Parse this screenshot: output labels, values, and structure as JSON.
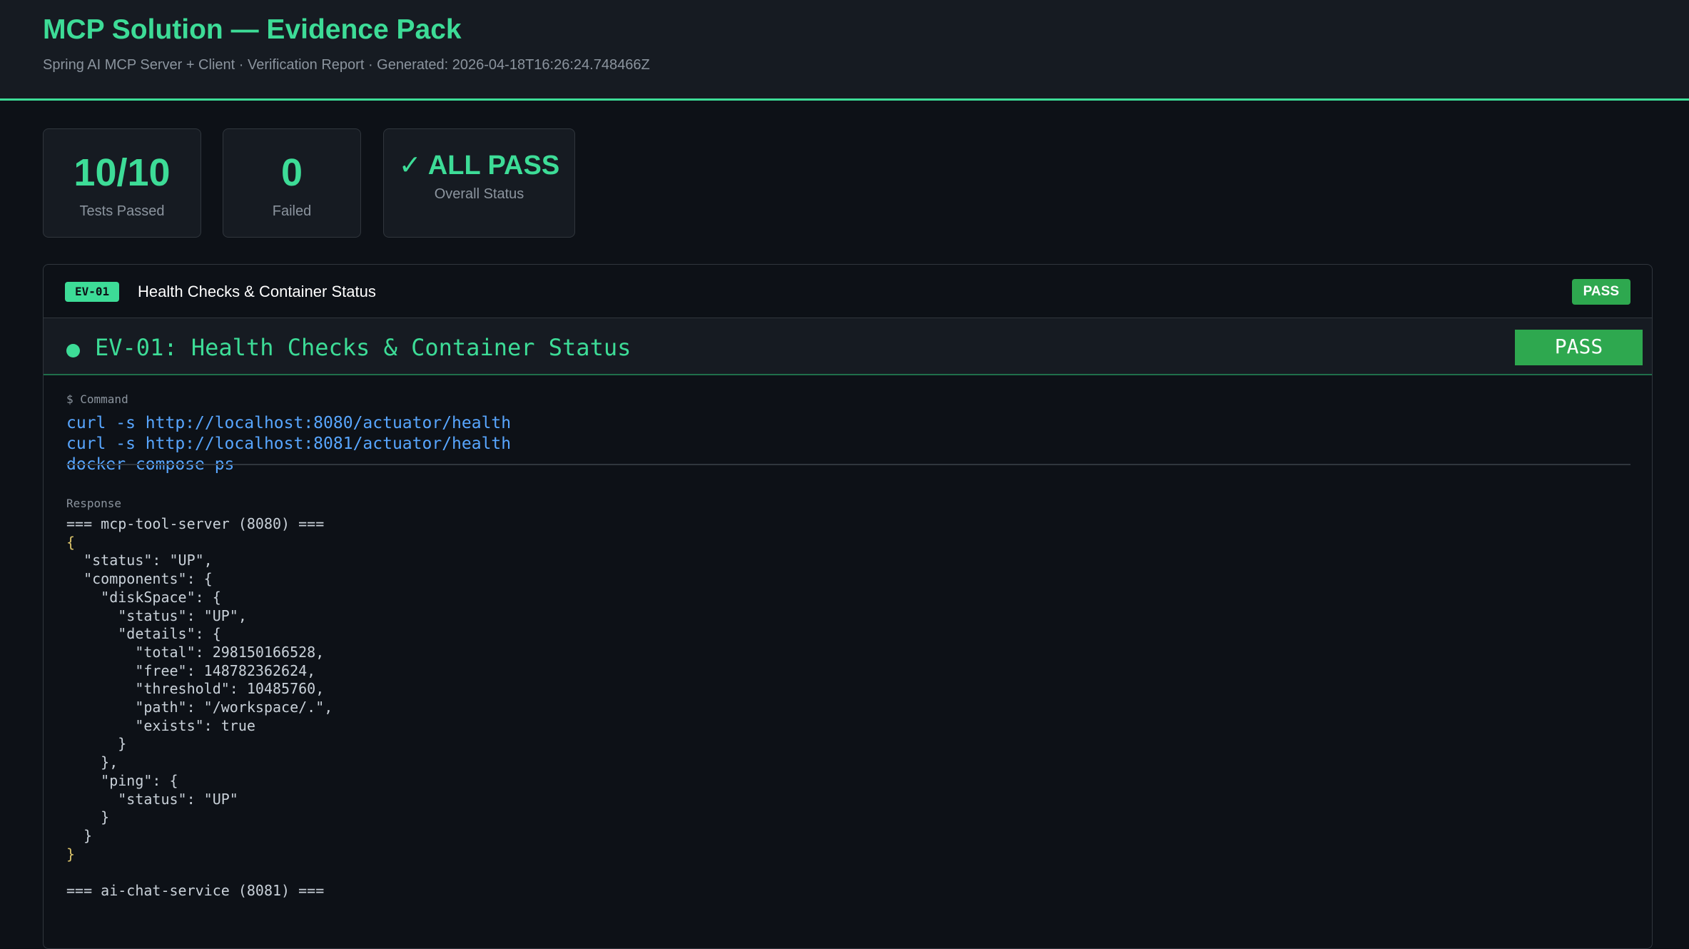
{
  "header": {
    "title": "MCP Solution — Evidence Pack",
    "subtitle": "Spring AI MCP Server + Client · Verification Report · Generated: 2026-04-18T16:26:24.748466Z"
  },
  "stats": {
    "passed": {
      "value": "10/10",
      "label": "Tests Passed"
    },
    "failed": {
      "value": "0",
      "label": "Failed"
    },
    "overall": {
      "value": "✓ ALL PASS",
      "label": "Overall Status"
    }
  },
  "colors": {
    "accent": "#3ddc97",
    "pass": "#2ea84f",
    "command": "#58a6ff",
    "background": "#0d1117",
    "panel": "#161b22"
  },
  "evidence": {
    "id": "EV-01",
    "title": "Health Checks & Container Status",
    "status": "PASS",
    "heading": "EV-01: Health Checks & Container Status",
    "heading_status": "PASS",
    "command_label": "$ Command",
    "commands": [
      "curl -s http://localhost:8080/actuator/health",
      "curl -s http://localhost:8081/actuator/health",
      "docker compose ps"
    ],
    "response_label": "Response",
    "response_lines": [
      "=== mcp-tool-server (8080) ===",
      "{",
      "  \"status\": \"UP\",",
      "  \"components\": {",
      "    \"diskSpace\": {",
      "      \"status\": \"UP\",",
      "      \"details\": {",
      "        \"total\": 298150166528,",
      "        \"free\": 148782362624,",
      "        \"threshold\": 10485760,",
      "        \"path\": \"/workspace/.\",",
      "        \"exists\": true",
      "      }",
      "    },",
      "    \"ping\": {",
      "      \"status\": \"UP\"",
      "    }",
      "  }",
      "}",
      "",
      "=== ai-chat-service (8081) ==="
    ]
  }
}
